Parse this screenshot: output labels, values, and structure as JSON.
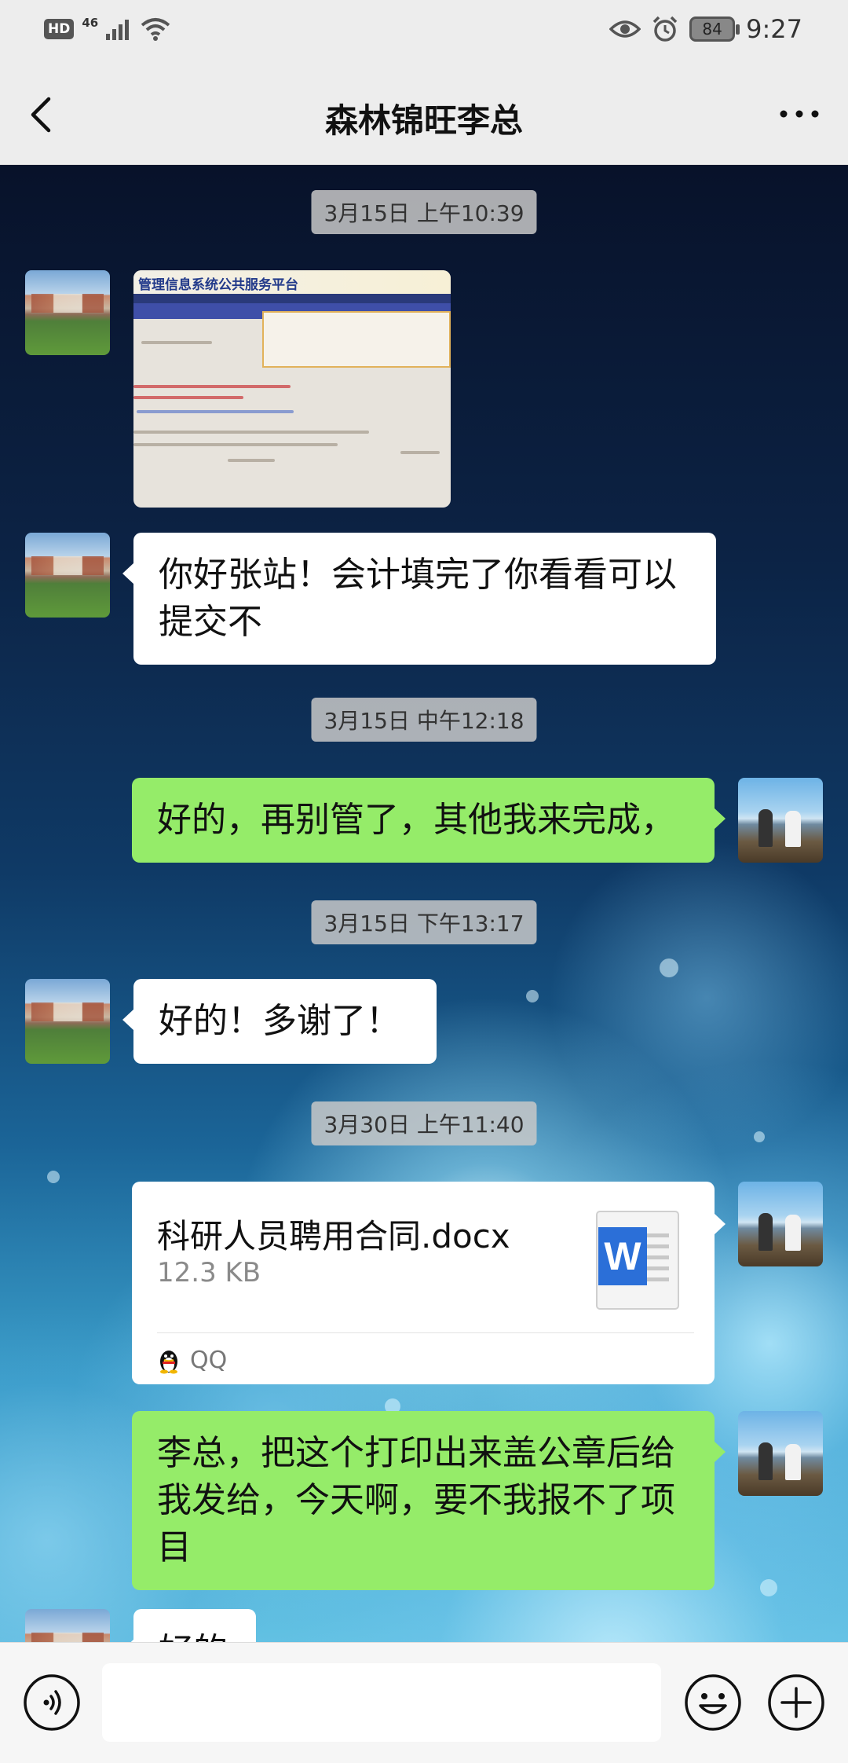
{
  "status_bar": {
    "hd": "HD",
    "network": "46",
    "battery": "84",
    "time": "9:27"
  },
  "header": {
    "title": "森林锦旺李总",
    "back_icon": "chevron-left-icon",
    "more_icon": "more-dots-icon"
  },
  "messages": [
    {
      "type": "timestamp",
      "text": "3月15日 上午10:39"
    },
    {
      "type": "image",
      "side": "left",
      "caption": "管理信息系统公共服务平台"
    },
    {
      "type": "text",
      "side": "left",
      "lines": [
        "你好张站！会计填完了你看看可以",
        "提交不"
      ]
    },
    {
      "type": "timestamp",
      "text": "3月15日 中午12:18"
    },
    {
      "type": "text",
      "side": "right",
      "lines": [
        "好的，再别管了，其他我来完成，"
      ]
    },
    {
      "type": "timestamp",
      "text": "3月15日 下午13:17"
    },
    {
      "type": "text",
      "side": "left",
      "lines": [
        "好的！多谢了！"
      ]
    },
    {
      "type": "timestamp",
      "text": "3月30日 上午11:40"
    },
    {
      "type": "file",
      "side": "right",
      "name": "科研人员聘用合同.docx",
      "size": "12.3 KB",
      "source": "QQ",
      "icon": "word-doc-icon"
    },
    {
      "type": "text",
      "side": "right",
      "lines": [
        "李总，把这个打印出来盖公章后给",
        "我发给，今天啊，要不我报不了项",
        "目"
      ]
    },
    {
      "type": "text",
      "side": "left",
      "lines": [
        "好的"
      ]
    }
  ],
  "input_bar": {
    "voice_icon": "voice-icon",
    "emoji_icon": "emoji-icon",
    "plus_icon": "plus-icon",
    "placeholder": ""
  },
  "colors": {
    "sent_bubble": "#95ec69",
    "received_bubble": "#ffffff",
    "bar_bg": "#ededed"
  }
}
